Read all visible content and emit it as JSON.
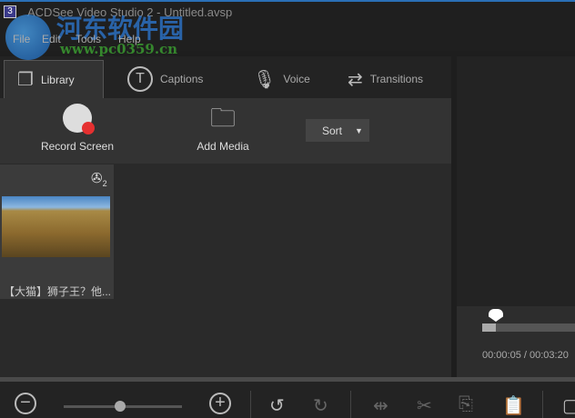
{
  "window": {
    "title": "ACDSee Video Studio 2 - Untitled.avsp"
  },
  "menu": [
    "File",
    "Edit",
    "Tools",
    "Help"
  ],
  "tabs": [
    {
      "label": "Library",
      "icon": "library-icon"
    },
    {
      "label": "Captions",
      "icon": "captions-icon"
    },
    {
      "label": "Voice",
      "icon": "microphone-icon"
    },
    {
      "label": "Transitions",
      "icon": "transitions-icon"
    }
  ],
  "toolbar": {
    "record": "Record Screen",
    "add_media": "Add Media",
    "sort": "Sort"
  },
  "media": [
    {
      "title": "【大猫】狮子王？他...",
      "badge": "2"
    }
  ],
  "player": {
    "time": "00:00:05 / 00:03:20",
    "progress": 0.03
  },
  "watermark": {
    "name": "河东软件园",
    "url": "www.pc0359.cn"
  }
}
